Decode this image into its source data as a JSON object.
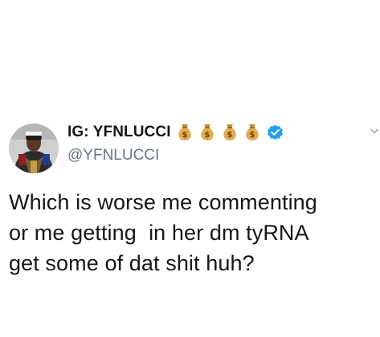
{
  "tweet": {
    "author": {
      "display_name": "IG: YFNLUCCI",
      "handle": "@YFNLUCCI",
      "name_emojis": [
        "money-bag",
        "money-bag",
        "money-bag",
        "money-bag"
      ],
      "money_bag_symbol": "$",
      "verified": true
    },
    "text_lines": [
      "Which is worse me commenting",
      "or me getting  in her dm tyRNA",
      "get some of dat shit huh?"
    ]
  },
  "colors": {
    "text": "#14171a",
    "secondary_text": "#657786",
    "verified_blue": "#1da1f2",
    "money_bag": "#d9a441",
    "background": "#ffffff"
  }
}
